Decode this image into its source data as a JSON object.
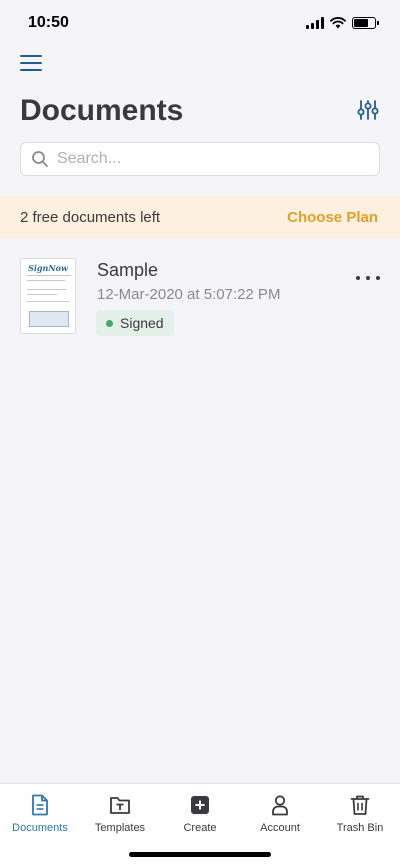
{
  "status_bar": {
    "time": "10:50",
    "battery_level": 0.7
  },
  "header": {
    "title": "Documents",
    "menu_icon": "hamburger-menu-icon",
    "filter_icon": "sliders-icon"
  },
  "search": {
    "placeholder": "Search...",
    "value": ""
  },
  "banner": {
    "text": "2 free documents left",
    "link": "Choose Plan"
  },
  "documents": [
    {
      "name": "Sample",
      "date": "12-Mar-2020 at 5:07:22 PM",
      "status": "Signed",
      "thumbnail_logo": "SignNow"
    }
  ],
  "tabs": [
    {
      "label": "Documents",
      "icon": "document-icon",
      "active": true
    },
    {
      "label": "Templates",
      "icon": "template-folder-icon",
      "active": false
    },
    {
      "label": "Create",
      "icon": "plus-square-icon",
      "active": false
    },
    {
      "label": "Account",
      "icon": "person-icon",
      "active": false
    },
    {
      "label": "Trash Bin",
      "icon": "trash-icon",
      "active": false
    }
  ],
  "colors": {
    "accent": "#2a7ab0",
    "banner_bg": "#fdf0df",
    "banner_link": "#e3a027",
    "signed_badge_bg": "#e3f1ea",
    "signed_dot": "#3fa96c"
  }
}
